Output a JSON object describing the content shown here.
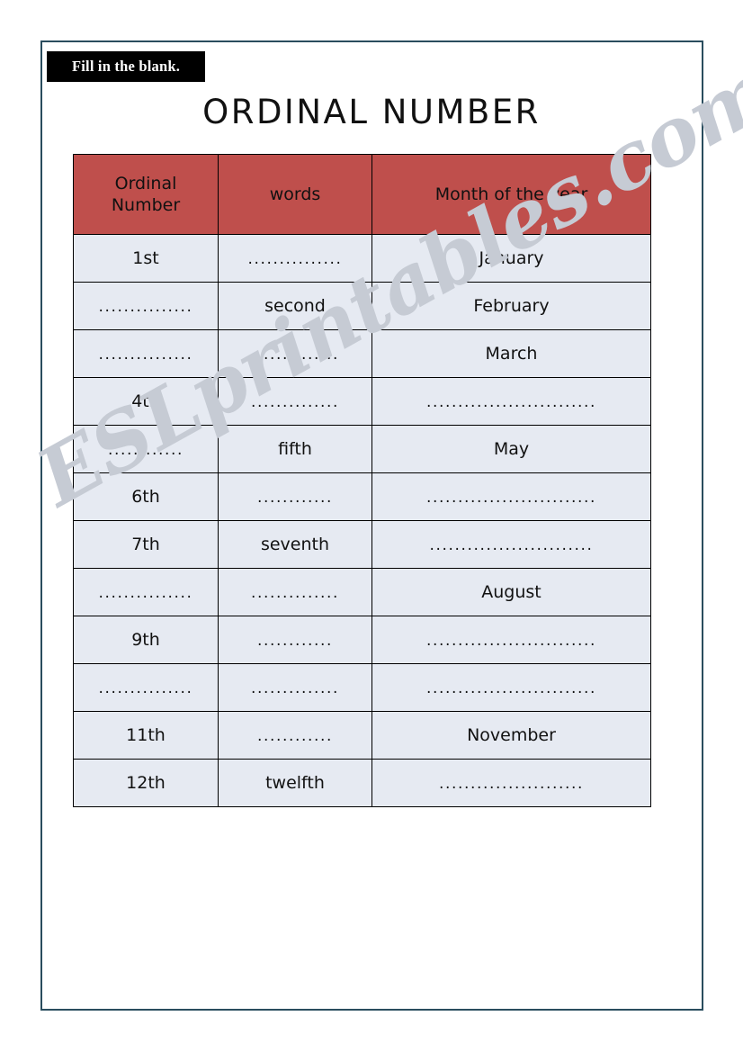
{
  "page": {
    "border_color": "#2a4d5e",
    "background": "#ffffff"
  },
  "instruction_tag": {
    "label": "Fill in the blank.",
    "background": "#000000",
    "text_color": "#ffffff"
  },
  "title": "ORDINAL NUMBER",
  "watermark": "ESLprintables.com",
  "table": {
    "header_background": "#bf4f4c",
    "cell_background": "#e6eaf2",
    "border_color": "#000000",
    "headers": [
      {
        "line1": "Ordinal",
        "line2": "Number"
      },
      {
        "line1": "words",
        "line2": ""
      },
      {
        "line1": "Month of the year",
        "line2": ""
      }
    ],
    "rows": [
      {
        "ordinal": "1st",
        "words": "...............",
        "month": "January"
      },
      {
        "ordinal": "...............",
        "words": "second",
        "month": "February"
      },
      {
        "ordinal": "...............",
        "words": "..............",
        "month": "March"
      },
      {
        "ordinal": "4th",
        "words": "..............",
        "month": "..........................."
      },
      {
        "ordinal": "............",
        "words": "fifth",
        "month": "May"
      },
      {
        "ordinal": "6th",
        "words": "............",
        "month": "..........................."
      },
      {
        "ordinal": "7th",
        "words": "seventh",
        "month": ".........................."
      },
      {
        "ordinal": "...............",
        "words": "..............",
        "month": "August"
      },
      {
        "ordinal": "9th",
        "words": "............",
        "month": "..........................."
      },
      {
        "ordinal": "...............",
        "words": "..............",
        "month": "..........................."
      },
      {
        "ordinal": "11th",
        "words": "............",
        "month": "November"
      },
      {
        "ordinal": "12th",
        "words": "twelfth",
        "month": "......................."
      }
    ]
  }
}
